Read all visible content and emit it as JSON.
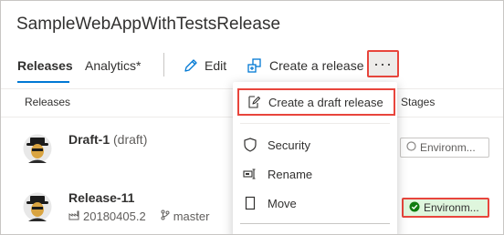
{
  "header": {
    "title": "SampleWebAppWithTestsRelease"
  },
  "tabs": [
    {
      "label": "Releases",
      "active": true
    },
    {
      "label": "Analytics*",
      "active": false
    }
  ],
  "toolbar": {
    "edit_label": "Edit",
    "create_release_label": "Create a release",
    "more_label": "···"
  },
  "table": {
    "columns": {
      "releases": "Releases",
      "stages": "Stages"
    },
    "rows": [
      {
        "name": "Draft-1",
        "suffix": "(draft)",
        "stage": "Environm...",
        "stage_status": "pending"
      },
      {
        "name": "Release-11",
        "build": "20180405.2",
        "branch": "master",
        "stage": "Environm...",
        "stage_status": "succeeded"
      }
    ]
  },
  "menu": {
    "items": [
      {
        "label": "Create a draft release",
        "icon": "edit-draft-icon"
      },
      {
        "label": "Security",
        "icon": "shield-icon"
      },
      {
        "label": "Rename",
        "icon": "rename-icon"
      },
      {
        "label": "Move",
        "icon": "move-icon"
      }
    ]
  },
  "colors": {
    "accent": "#0078d4",
    "highlight_border": "#e8453c",
    "success_bg": "#dff6dd",
    "success_icon": "#107c10"
  }
}
